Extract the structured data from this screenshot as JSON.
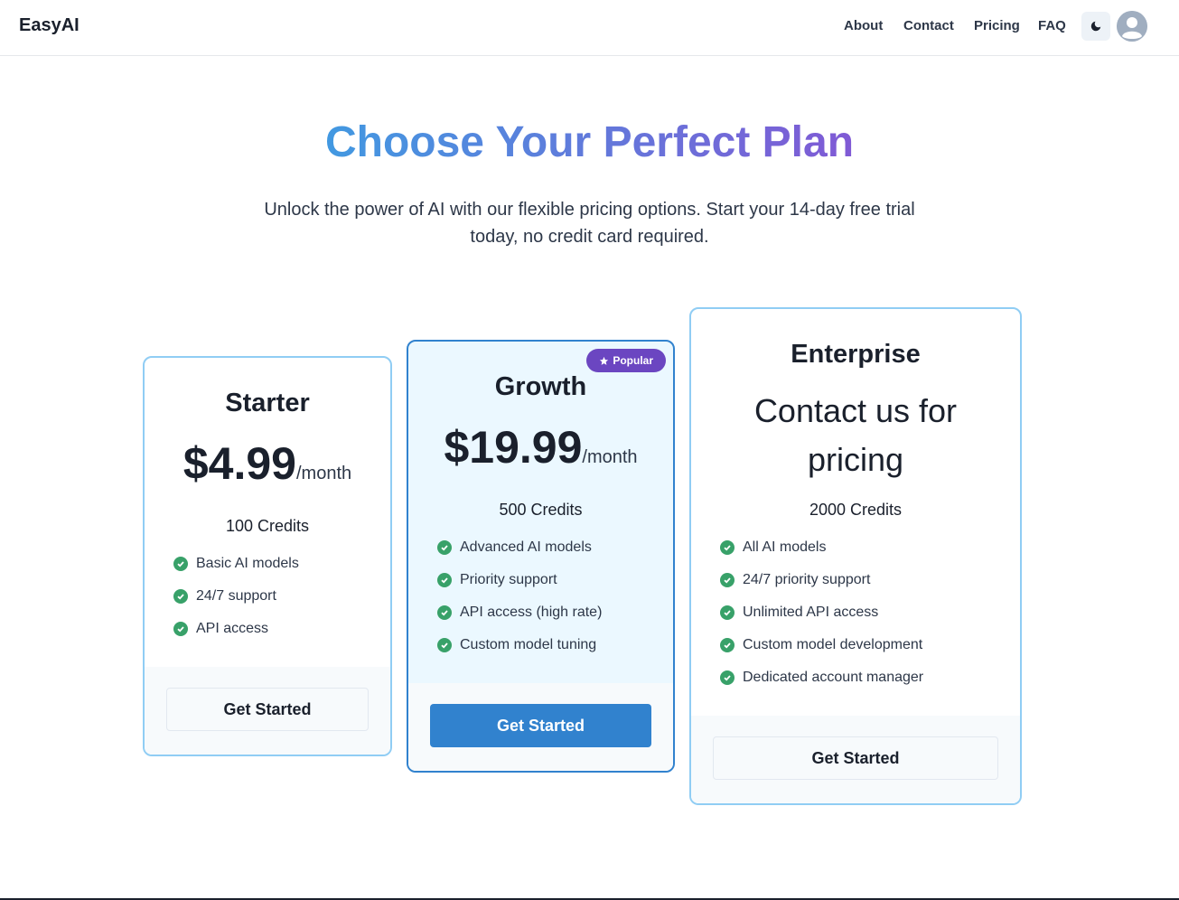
{
  "header": {
    "brand": "EasyAI",
    "nav": [
      "About",
      "Contact",
      "Pricing",
      "FAQ"
    ]
  },
  "hero": {
    "title": "Choose Your Perfect Plan",
    "subtitle": "Unlock the power of AI with our flexible pricing options. Start your 14-day free trial today, no credit card required."
  },
  "plans": [
    {
      "name": "Starter",
      "price": "$4.99",
      "period": "/month",
      "credits": "100 Credits",
      "features": [
        "Basic AI models",
        "24/7 support",
        "API access"
      ],
      "cta": "Get Started"
    },
    {
      "name": "Growth",
      "badge": "Popular",
      "price": "$19.99",
      "period": "/month",
      "credits": "500 Credits",
      "features": [
        "Advanced AI models",
        "Priority support",
        "API access (high rate)",
        "Custom model tuning"
      ],
      "cta": "Get Started"
    },
    {
      "name": "Enterprise",
      "price_text": "Contact us for pricing",
      "credits": "2000 Credits",
      "features": [
        "All AI models",
        "24/7 priority support",
        "Unlimited API access",
        "Custom model development",
        "Dedicated account manager"
      ],
      "cta": "Get Started"
    }
  ],
  "icons": {
    "theme": "moon-icon",
    "avatar": "user-avatar-icon",
    "feature": "check-circle-icon",
    "badge": "star-icon"
  },
  "colors": {
    "accent": "#3182ce",
    "card_border": "#90cdf4",
    "badge": "#6b46c1",
    "check": "#38a169",
    "title_gradient_start": "#4299e1",
    "title_gradient_end": "#805ad5"
  }
}
